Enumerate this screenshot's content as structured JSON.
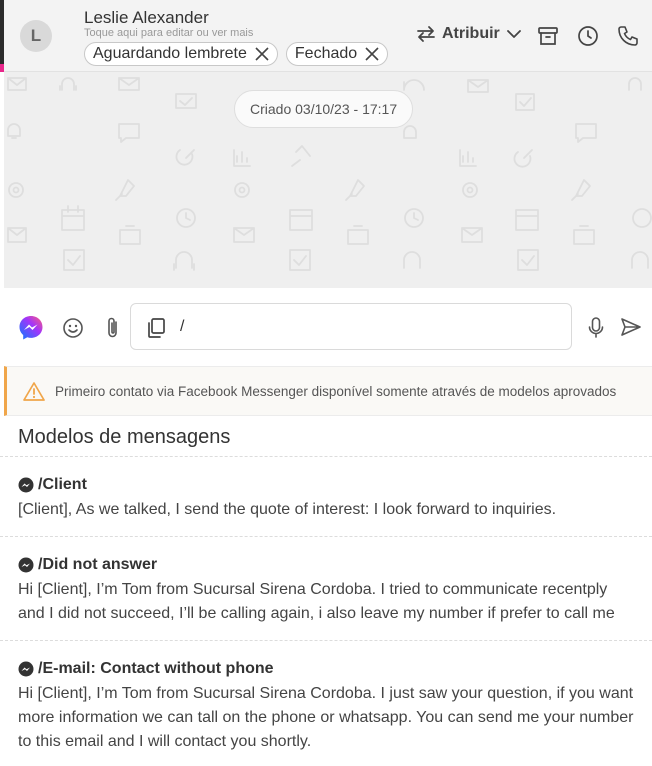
{
  "header": {
    "avatar_initial": "L",
    "contact_name": "Leslie Alexander",
    "contact_hint": "Toque aqui para editar ou ver mais",
    "tags": [
      {
        "label": "Aguardando lembrete"
      },
      {
        "label": "Fechado"
      }
    ],
    "assign_label": "Atribuir",
    "icons": [
      "swap-icon",
      "chevron-down-icon",
      "archive-icon",
      "clock-icon",
      "phone-icon"
    ]
  },
  "chat": {
    "created_label": "Criado 03/10/23 - 17:17"
  },
  "composer": {
    "channel_icon": "messenger-icon",
    "message_value": "/",
    "icons": [
      "emoji-icon",
      "paperclip-icon",
      "copy-icon",
      "microphone-icon",
      "send-icon"
    ]
  },
  "warning": {
    "text": "Primeiro contato via Facebook Messenger disponível somente através de modelos aprovados"
  },
  "templates": {
    "title": "Modelos de mensagens",
    "items": [
      {
        "name": "/Client",
        "body": "[Client], As we talked, I send the quote of interest: I look forward to inquiries."
      },
      {
        "name": "/Did not answer",
        "body": "Hi [Client], I’m Tom from Sucursal Sirena Cordoba. I tried to communicate recentply and I did not succeed, I’ll be calling again, i also leave my number if prefer to call me"
      },
      {
        "name": "/E-mail: Contact without phone",
        "body": "Hi [Client], I’m Tom from Sucursal Sirena Cordoba. I just saw your question, if you want more information we can tall on the phone or whatsapp. You can send me your number to this email and I will contact you shortly."
      }
    ]
  },
  "colors": {
    "accent_pink": "#e8278b",
    "warning_orange": "#f0a64a",
    "messenger_blue": "#0a7cff",
    "messenger_purple": "#a334fa"
  }
}
